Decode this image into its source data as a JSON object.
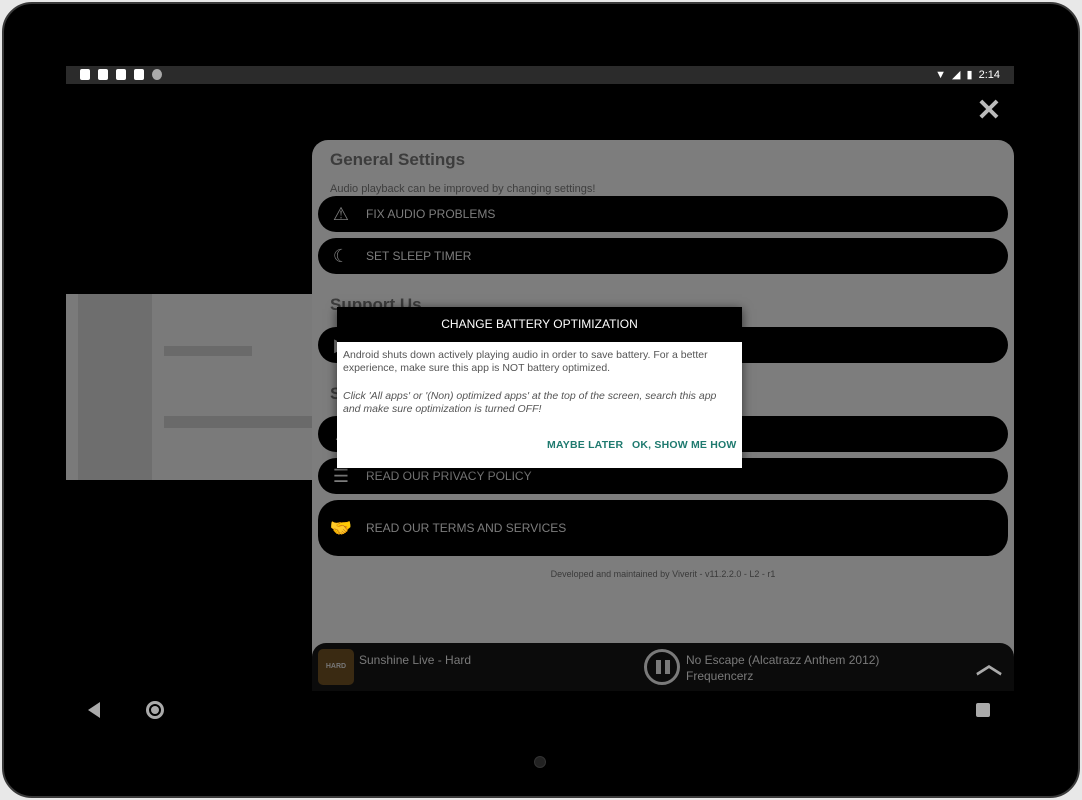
{
  "status_bar": {
    "time": "2:14"
  },
  "panel": {
    "title": "General Settings",
    "subtitle": "Audio playback can be improved by changing settings!",
    "items": [
      {
        "label": "FIX AUDIO PROBLEMS",
        "icon": "warning-icon"
      },
      {
        "label": "SET SLEEP TIMER",
        "icon": "sleep-moon-icon"
      }
    ],
    "support_title": "Support Us",
    "section_letter": "S",
    "links": [
      {
        "label": "READ OUR PRIVACY POLICY",
        "icon": "list-icon"
      },
      {
        "label": "READ OUR TERMS AND SERVICES",
        "icon": "handshake-icon"
      }
    ],
    "footer": "Developed and maintained by Viverit - v11.2.2.0 - L2 - r1"
  },
  "player": {
    "album_label": "HARD",
    "current_track": "Sunshine Live - Hard",
    "now_playing_title": "No Escape (Alcatrazz Anthem 2012)",
    "now_playing_artist": "Frequencerz"
  },
  "dialog": {
    "title": "CHANGE BATTERY OPTIMIZATION",
    "body1": "Android shuts down actively playing audio in order to save battery. For a better experience, make sure this app is NOT battery optimized.",
    "body2": "Click 'All apps' or '(Non) optimized apps' at the top of the screen, search this app and make sure optimization is turned OFF!",
    "btn_later": "MAYBE LATER",
    "btn_show": "OK, SHOW ME HOW"
  }
}
